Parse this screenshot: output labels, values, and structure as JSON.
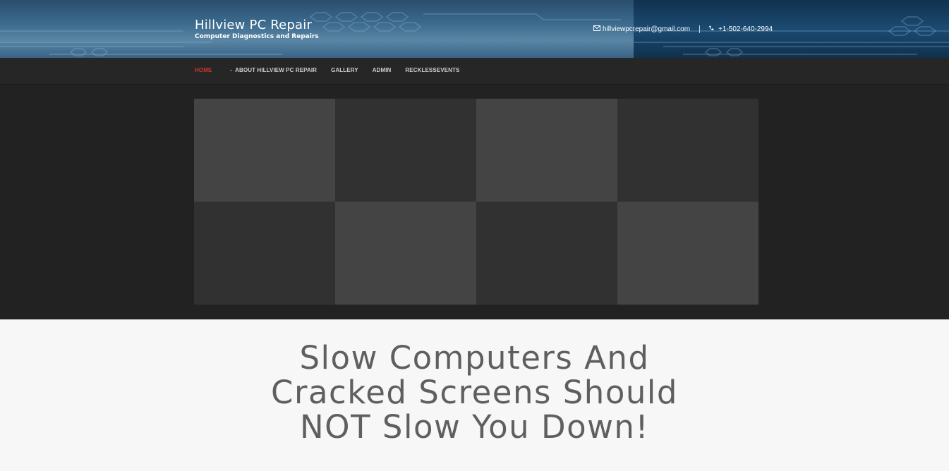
{
  "site": {
    "title": "Hillview PC Repair",
    "tagline": "Computer Diagnostics and Repairs"
  },
  "contact": {
    "email": "hillviewpcrepair@gmail.com",
    "phone": "+1-502-640-2994",
    "email_icon": "envelope-icon",
    "phone_icon": "phone-icon"
  },
  "nav": {
    "items": [
      {
        "label": "HOME",
        "active": true
      },
      {
        "label": "ABOUT HILLVIEW PC REPAIR",
        "prefix": "-"
      },
      {
        "label": "GALLERY"
      },
      {
        "label": "ADMIN"
      },
      {
        "label": "RECKLESSEVENTS"
      }
    ]
  },
  "hero": {
    "lines": [
      "Slow Computers And",
      "Cracked Screens Should",
      "NOT Slow You Down!"
    ]
  },
  "colors": {
    "accent": "#d0342c",
    "nav_bg": "#262626",
    "hero_text": "#5f5f5f"
  }
}
